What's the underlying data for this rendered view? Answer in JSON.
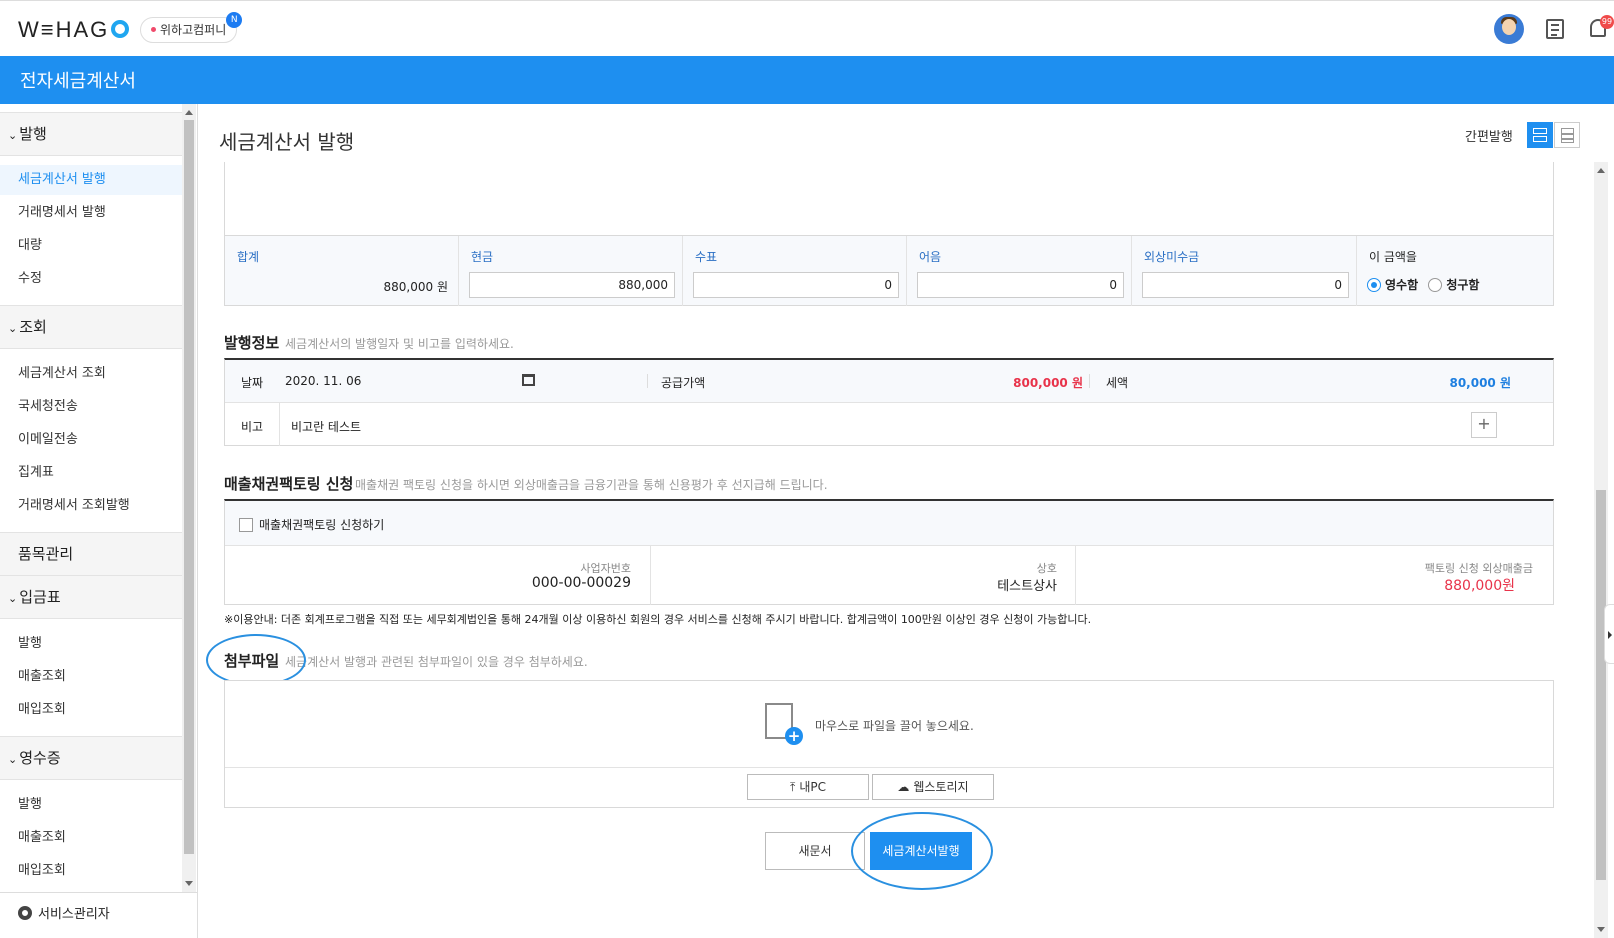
{
  "topbar": {
    "logo": "W≡HAG",
    "company": "위하고컴퍼니",
    "company_badge": "N",
    "notification_count": "99"
  },
  "app_title": "전자세금계산서",
  "sidebar": {
    "sections": [
      {
        "label": "발행",
        "items": [
          "세금계산서 발행",
          "거래명세서 발행",
          "대량",
          "수정"
        ]
      },
      {
        "label": "조회",
        "items": [
          "세금계산서 조회",
          "국세청전송",
          "이메일전송",
          "집계표",
          "거래명세서 조회발행"
        ]
      },
      {
        "label": "품목관리",
        "items": []
      },
      {
        "label": "입금표",
        "items": [
          "발행",
          "매출조회",
          "매입조회"
        ]
      },
      {
        "label": "영수증",
        "items": [
          "발행",
          "매출조회",
          "매입조회"
        ]
      }
    ],
    "active_item": "세금계산서 발행",
    "footer": "서비스관리자"
  },
  "main": {
    "title": "세금계산서 발행",
    "quick_label": "간편발행",
    "payment": {
      "total_label": "합계",
      "total_value": "880,000 원",
      "cash_label": "현금",
      "cash_value": "880,000",
      "check_label": "수표",
      "check_value": "0",
      "note_label": "어음",
      "note_value": "0",
      "credit_label": "외상미수금",
      "credit_value": "0",
      "amount_label": "이 금액을",
      "receipt_option": "영수함",
      "claim_option": "청구함",
      "selected": "영수함"
    },
    "issue_info": {
      "title": "발행정보",
      "desc": "세금계산서의 발행일자 및 비고를 입력하세요.",
      "date_label": "날짜",
      "date_value": "2020. 11. 06",
      "supply_label": "공급가액",
      "supply_value": "800,000 원",
      "tax_label": "세액",
      "tax_value": "80,000 원",
      "remark_label": "비고",
      "remark_value": "비고란 테스트",
      "add_btn": "+"
    },
    "factoring": {
      "title": "매출채권팩토링 신청",
      "desc": "매출채권 팩토링 신청을 하시면 외상매출금을 금융기관을 통해 신용평가 후 선지급해 드립니다.",
      "checkbox_label": "매출채권팩토링 신청하기",
      "biz_no_label": "사업자번호",
      "biz_no_value": "000-00-00029",
      "company_label": "상호",
      "company_value": "테스트상사",
      "amount_label": "팩토링 신청 외상매출금",
      "amount_value": "880,000원",
      "notice": "※이용안내: 더존 회계프로그램을 직접 또는 세무회계법인을 통해 24개월 이상 이용하신 회원의 경우 서비스를 신청해 주시기 바랍니다. 합계금액이 100만원 이상인 경우 신청이 가능합니다."
    },
    "attachment": {
      "title": "첨부파일",
      "desc": "세금계산서 발행과 관련된 첨부파일이 있을 경우 첨부하세요.",
      "drop_text": "마우스로 파일을 끌어 놓으세요.",
      "my_pc": "내PC",
      "web_storage": "웹스토리지"
    },
    "actions": {
      "new_doc": "새문서",
      "issue": "세금계산서발행"
    }
  },
  "colors": {
    "brand": "#1e8ff0",
    "supply_red": "#e8334a",
    "tax_blue": "#1e7fe0"
  }
}
